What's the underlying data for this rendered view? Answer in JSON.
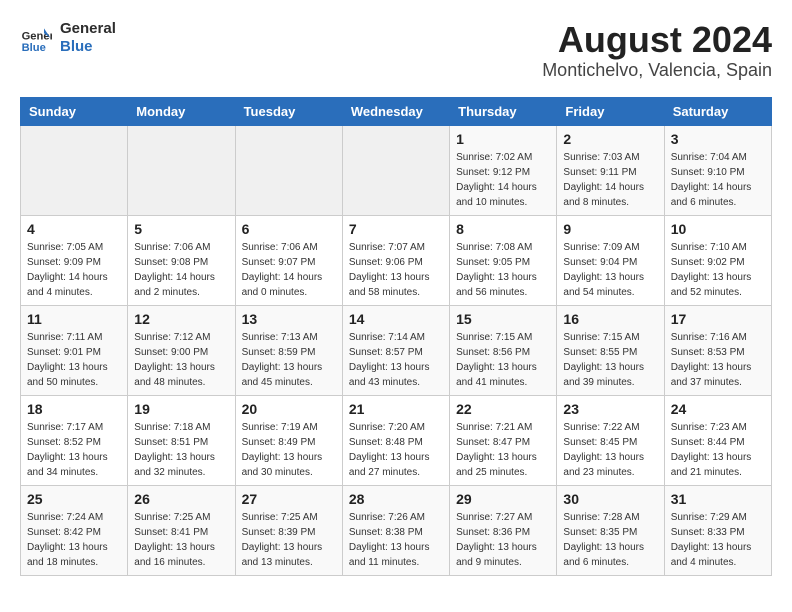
{
  "header": {
    "logo_general": "General",
    "logo_blue": "Blue",
    "title": "August 2024",
    "subtitle": "Montichelvo, Valencia, Spain"
  },
  "calendar": {
    "days_of_week": [
      "Sunday",
      "Monday",
      "Tuesday",
      "Wednesday",
      "Thursday",
      "Friday",
      "Saturday"
    ],
    "weeks": [
      [
        {
          "day": "",
          "info": ""
        },
        {
          "day": "",
          "info": ""
        },
        {
          "day": "",
          "info": ""
        },
        {
          "day": "",
          "info": ""
        },
        {
          "day": "1",
          "info": "Sunrise: 7:02 AM\nSunset: 9:12 PM\nDaylight: 14 hours and 10 minutes."
        },
        {
          "day": "2",
          "info": "Sunrise: 7:03 AM\nSunset: 9:11 PM\nDaylight: 14 hours and 8 minutes."
        },
        {
          "day": "3",
          "info": "Sunrise: 7:04 AM\nSunset: 9:10 PM\nDaylight: 14 hours and 6 minutes."
        }
      ],
      [
        {
          "day": "4",
          "info": "Sunrise: 7:05 AM\nSunset: 9:09 PM\nDaylight: 14 hours and 4 minutes."
        },
        {
          "day": "5",
          "info": "Sunrise: 7:06 AM\nSunset: 9:08 PM\nDaylight: 14 hours and 2 minutes."
        },
        {
          "day": "6",
          "info": "Sunrise: 7:06 AM\nSunset: 9:07 PM\nDaylight: 14 hours and 0 minutes."
        },
        {
          "day": "7",
          "info": "Sunrise: 7:07 AM\nSunset: 9:06 PM\nDaylight: 13 hours and 58 minutes."
        },
        {
          "day": "8",
          "info": "Sunrise: 7:08 AM\nSunset: 9:05 PM\nDaylight: 13 hours and 56 minutes."
        },
        {
          "day": "9",
          "info": "Sunrise: 7:09 AM\nSunset: 9:04 PM\nDaylight: 13 hours and 54 minutes."
        },
        {
          "day": "10",
          "info": "Sunrise: 7:10 AM\nSunset: 9:02 PM\nDaylight: 13 hours and 52 minutes."
        }
      ],
      [
        {
          "day": "11",
          "info": "Sunrise: 7:11 AM\nSunset: 9:01 PM\nDaylight: 13 hours and 50 minutes."
        },
        {
          "day": "12",
          "info": "Sunrise: 7:12 AM\nSunset: 9:00 PM\nDaylight: 13 hours and 48 minutes."
        },
        {
          "day": "13",
          "info": "Sunrise: 7:13 AM\nSunset: 8:59 PM\nDaylight: 13 hours and 45 minutes."
        },
        {
          "day": "14",
          "info": "Sunrise: 7:14 AM\nSunset: 8:57 PM\nDaylight: 13 hours and 43 minutes."
        },
        {
          "day": "15",
          "info": "Sunrise: 7:15 AM\nSunset: 8:56 PM\nDaylight: 13 hours and 41 minutes."
        },
        {
          "day": "16",
          "info": "Sunrise: 7:15 AM\nSunset: 8:55 PM\nDaylight: 13 hours and 39 minutes."
        },
        {
          "day": "17",
          "info": "Sunrise: 7:16 AM\nSunset: 8:53 PM\nDaylight: 13 hours and 37 minutes."
        }
      ],
      [
        {
          "day": "18",
          "info": "Sunrise: 7:17 AM\nSunset: 8:52 PM\nDaylight: 13 hours and 34 minutes."
        },
        {
          "day": "19",
          "info": "Sunrise: 7:18 AM\nSunset: 8:51 PM\nDaylight: 13 hours and 32 minutes."
        },
        {
          "day": "20",
          "info": "Sunrise: 7:19 AM\nSunset: 8:49 PM\nDaylight: 13 hours and 30 minutes."
        },
        {
          "day": "21",
          "info": "Sunrise: 7:20 AM\nSunset: 8:48 PM\nDaylight: 13 hours and 27 minutes."
        },
        {
          "day": "22",
          "info": "Sunrise: 7:21 AM\nSunset: 8:47 PM\nDaylight: 13 hours and 25 minutes."
        },
        {
          "day": "23",
          "info": "Sunrise: 7:22 AM\nSunset: 8:45 PM\nDaylight: 13 hours and 23 minutes."
        },
        {
          "day": "24",
          "info": "Sunrise: 7:23 AM\nSunset: 8:44 PM\nDaylight: 13 hours and 21 minutes."
        }
      ],
      [
        {
          "day": "25",
          "info": "Sunrise: 7:24 AM\nSunset: 8:42 PM\nDaylight: 13 hours and 18 minutes."
        },
        {
          "day": "26",
          "info": "Sunrise: 7:25 AM\nSunset: 8:41 PM\nDaylight: 13 hours and 16 minutes."
        },
        {
          "day": "27",
          "info": "Sunrise: 7:25 AM\nSunset: 8:39 PM\nDaylight: 13 hours and 13 minutes."
        },
        {
          "day": "28",
          "info": "Sunrise: 7:26 AM\nSunset: 8:38 PM\nDaylight: 13 hours and 11 minutes."
        },
        {
          "day": "29",
          "info": "Sunrise: 7:27 AM\nSunset: 8:36 PM\nDaylight: 13 hours and 9 minutes."
        },
        {
          "day": "30",
          "info": "Sunrise: 7:28 AM\nSunset: 8:35 PM\nDaylight: 13 hours and 6 minutes."
        },
        {
          "day": "31",
          "info": "Sunrise: 7:29 AM\nSunset: 8:33 PM\nDaylight: 13 hours and 4 minutes."
        }
      ]
    ]
  }
}
